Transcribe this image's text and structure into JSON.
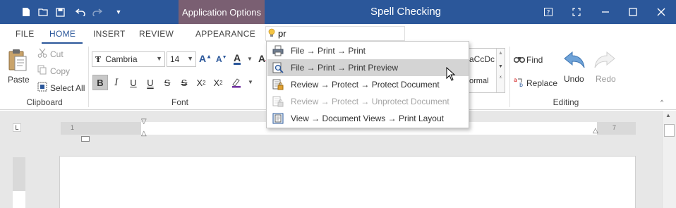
{
  "window": {
    "title": "Spell Checking",
    "app_options_label": "Application Options"
  },
  "colors": {
    "title_bar": "#2b579a",
    "app_options_bg": "#7a5f72",
    "accent": "#2b579a",
    "hover_item": "#d4d4d4"
  },
  "tabs": [
    {
      "label": "FILE"
    },
    {
      "label": "HOME"
    },
    {
      "label": "INSERT"
    },
    {
      "label": "REVIEW"
    },
    {
      "label": "APPEARANCE"
    }
  ],
  "active_tab": "HOME",
  "search": {
    "value": "pr"
  },
  "clipboard": {
    "paste_label": "Paste",
    "cut_label": "Cut",
    "copy_label": "Copy",
    "select_all_label": "Select All",
    "group_label": "Clipboard"
  },
  "font": {
    "family": "Cambria",
    "size": "14",
    "group_label": "Font"
  },
  "styles": {
    "preview_text": "aCcDc",
    "preview_name": "ormal"
  },
  "editing": {
    "find_label": "Find",
    "replace_label": "Replace",
    "undo_label": "Undo",
    "redo_label": "Redo",
    "group_label": "Editing"
  },
  "dropdown": {
    "items": [
      {
        "label": "File → Print → Print",
        "icon": "printer-icon",
        "state": "normal"
      },
      {
        "label": "File → Print → Print Preview",
        "icon": "print-preview-icon",
        "state": "hover"
      },
      {
        "label": "Review → Protect → Protect Document",
        "icon": "protect-document-icon",
        "state": "normal"
      },
      {
        "label": "Review → Protect → Unprotect Document",
        "icon": "unprotect-document-icon",
        "state": "disabled"
      },
      {
        "label": "View → Document Views → Print Layout",
        "icon": "print-layout-icon",
        "state": "normal"
      }
    ]
  },
  "ruler": {
    "left_mark": "1",
    "right_mark": "7"
  }
}
